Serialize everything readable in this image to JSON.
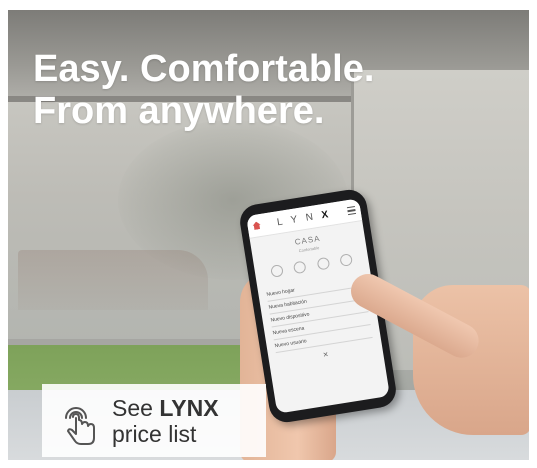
{
  "headline": {
    "line1": "Easy. Comfortable.",
    "line2": "From anywhere."
  },
  "phone_app": {
    "logo_letters": "L Y N",
    "logo_bold": "X",
    "title": "CASA",
    "subtitle": "Confortable",
    "menu_items": [
      "Nuevo hogar",
      "Nueva habitación",
      "Nuevo dispositivo",
      "Nueva escena",
      "Nuevo usuario"
    ],
    "close": "×",
    "icons": [
      "home-icon",
      "menu-icon"
    ]
  },
  "cta": {
    "prefix": "See ",
    "brand": "LYNX",
    "line2": "price list",
    "icon": "touch-hand-icon"
  },
  "colors": {
    "cta_bg": "#ffffff",
    "headline": "#ffffff"
  }
}
